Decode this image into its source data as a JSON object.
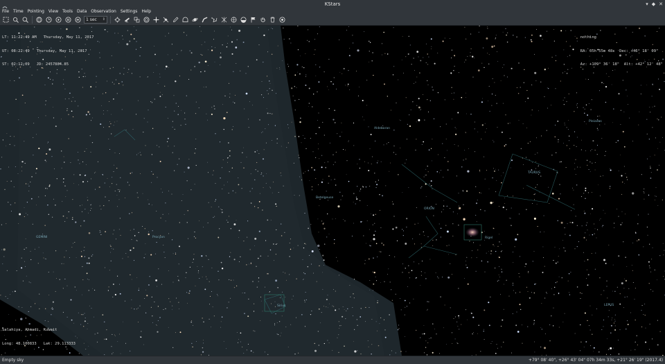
{
  "window": {
    "title": "KStars"
  },
  "menu": [
    "File",
    "Time",
    "Pointing",
    "View",
    "Tools",
    "Data",
    "Observation",
    "Settings",
    "Help"
  ],
  "toolbar": {
    "time_step_value": "1 sec",
    "icons": [
      "zoom-fit-icon",
      "zoom-in-icon",
      "search-icon",
      "globe-icon",
      "clock-icon",
      "play-icon",
      "pause-icon",
      "forward-icon",
      "time-step-field",
      "target-icon",
      "telescope-icon",
      "scope-alt-icon",
      "skyview-icon",
      "crosshair-icon",
      "satellite-icon",
      "pencil-icon",
      "horizon-icon",
      "planet-icon",
      "milky-way-icon",
      "constellation-lines-icon",
      "constellation-art-icon",
      "grid-icon",
      "ground-icon",
      "flag-icon",
      "hand-icon",
      "trash-icon",
      "eye-icon"
    ]
  },
  "info": {
    "time": {
      "lt": "LT: 11:22:49 AM   Thursday, May 11, 2017",
      "ut": "UT: 08:22:49   Thursday, May 11, 2017",
      "st": "ST: 02:12:09   JD: 2457884.85"
    },
    "focus": {
      "name": "nothing",
      "radec": "RA: 05h 55m 48s  Dec: +46° 18' 09\"",
      "azalt": "Az: +109° 36' 18\"  Alt: +42° 12' 48\""
    },
    "geo": {
      "location": "Salahiya, Ahmadi, Kuwait",
      "coords": "Long: 48.100833   Lat: 29.113333"
    }
  },
  "sky_labels": [
    "GEMINI",
    "Betelgeuse",
    "ORION",
    "Rigel",
    "TAURUS",
    "Aldebaran",
    "Pleiades",
    "LEPUS",
    "Sirius",
    "Procyon"
  ],
  "status": {
    "left": "Empty sky",
    "right": "+79° 08' 40\", +26° 43' 04\"  07h 34m 33s, +21° 26' 19\" (2017.4)"
  }
}
